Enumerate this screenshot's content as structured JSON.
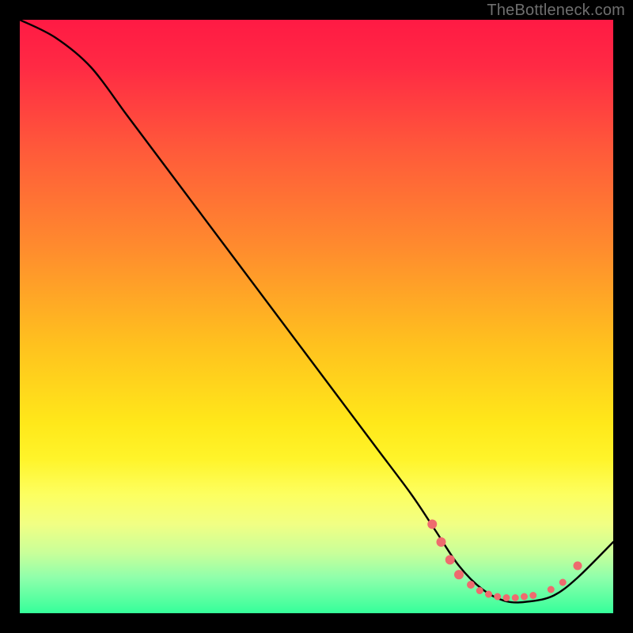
{
  "watermark": "TheBottleneck.com",
  "chart_data": {
    "type": "line",
    "title": "",
    "xlabel": "",
    "ylabel": "",
    "xlim": [
      0,
      100
    ],
    "ylim": [
      0,
      100
    ],
    "grid": false,
    "series": [
      {
        "name": "bottleneck-curve",
        "x": [
          0,
          6,
          12,
          18,
          24,
          30,
          36,
          42,
          48,
          54,
          60,
          66,
          70,
          74,
          78,
          82,
          86,
          90,
          94,
          100
        ],
        "y": [
          100,
          97,
          92,
          84,
          76,
          68,
          60,
          52,
          44,
          36,
          28,
          20,
          14,
          8,
          4,
          2,
          2,
          3,
          6,
          12
        ],
        "stroke": "#000000",
        "stroke_width": 2.4
      }
    ],
    "points": [
      {
        "name": "marker-a",
        "x": 69.5,
        "y": 15.0,
        "r": 6.0,
        "color": "#ee6b6e"
      },
      {
        "name": "marker-b",
        "x": 71.0,
        "y": 12.0,
        "r": 6.0,
        "color": "#ee6b6e"
      },
      {
        "name": "marker-c",
        "x": 72.5,
        "y": 9.0,
        "r": 6.0,
        "color": "#ee6b6e"
      },
      {
        "name": "marker-d",
        "x": 74.0,
        "y": 6.5,
        "r": 6.0,
        "color": "#ee6b6e"
      },
      {
        "name": "marker-e",
        "x": 76.0,
        "y": 4.8,
        "r": 5.0,
        "color": "#ee6b6e"
      },
      {
        "name": "marker-f",
        "x": 77.5,
        "y": 3.8,
        "r": 4.5,
        "color": "#ee6b6e"
      },
      {
        "name": "marker-g",
        "x": 79.0,
        "y": 3.2,
        "r": 4.5,
        "color": "#ee6b6e"
      },
      {
        "name": "marker-h",
        "x": 80.5,
        "y": 2.8,
        "r": 4.5,
        "color": "#ee6b6e"
      },
      {
        "name": "marker-i",
        "x": 82.0,
        "y": 2.6,
        "r": 4.5,
        "color": "#ee6b6e"
      },
      {
        "name": "marker-j",
        "x": 83.5,
        "y": 2.6,
        "r": 4.5,
        "color": "#ee6b6e"
      },
      {
        "name": "marker-k",
        "x": 85.0,
        "y": 2.8,
        "r": 4.5,
        "color": "#ee6b6e"
      },
      {
        "name": "marker-l",
        "x": 86.5,
        "y": 3.0,
        "r": 4.5,
        "color": "#ee6b6e"
      },
      {
        "name": "marker-m",
        "x": 89.5,
        "y": 4.0,
        "r": 4.5,
        "color": "#ee6b6e"
      },
      {
        "name": "marker-n",
        "x": 91.5,
        "y": 5.2,
        "r": 4.5,
        "color": "#ee6b6e"
      },
      {
        "name": "marker-o",
        "x": 94.0,
        "y": 8.0,
        "r": 5.5,
        "color": "#ee6b6e"
      }
    ]
  }
}
